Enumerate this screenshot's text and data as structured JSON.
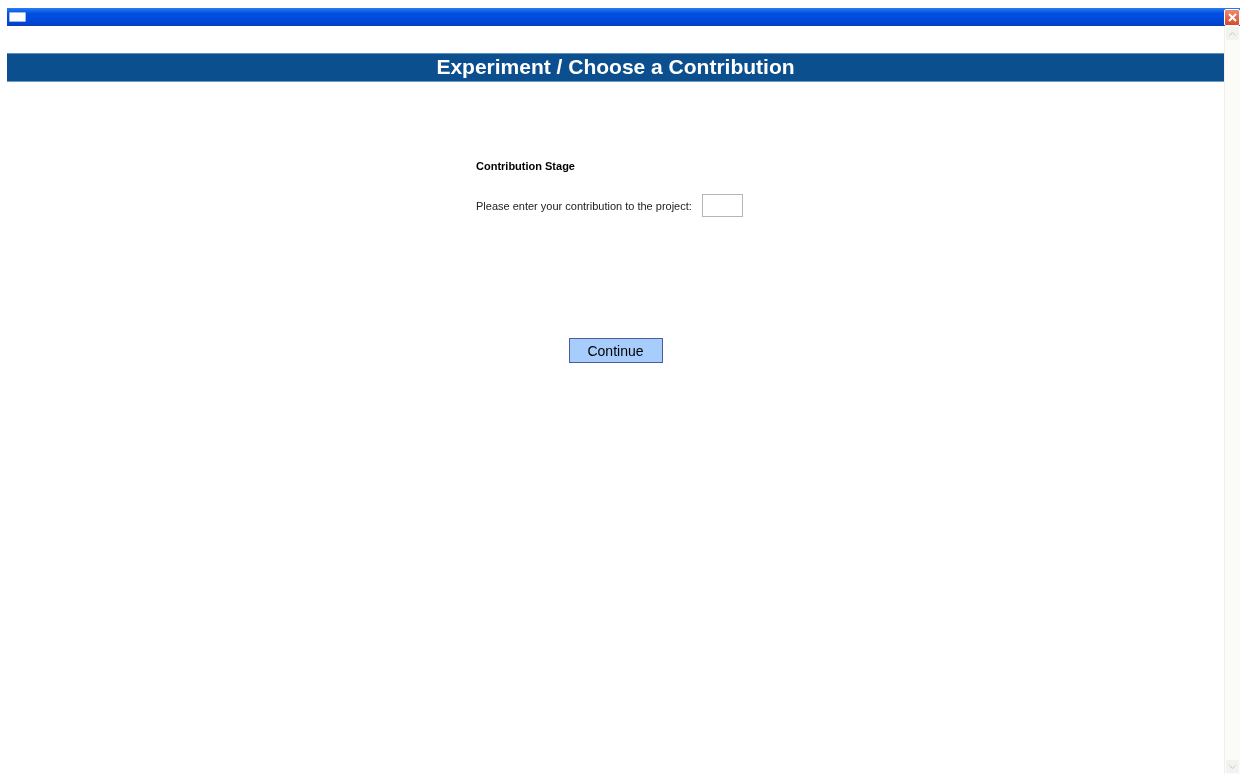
{
  "page": {
    "heading": "Experiment / Choose a Contribution"
  },
  "form": {
    "section_title": "Contribution Stage",
    "prompt": "Please enter your contribution to the project:"
  },
  "buttons": [
    "Continue"
  ]
}
